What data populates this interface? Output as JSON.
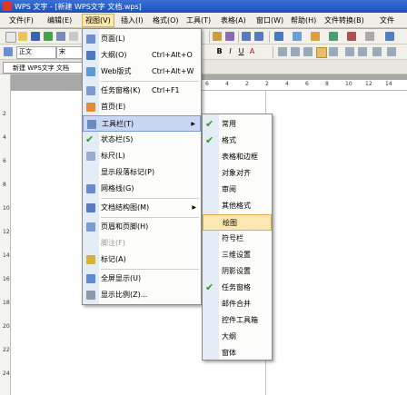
{
  "window": {
    "title": "WPS 文字 - [新建 WPS文字 文档.wps]"
  },
  "menubar": {
    "items": [
      "文件(F)",
      "编辑(E)",
      "视图(V)",
      "插入(I)",
      "格式(O)",
      "工具(T)",
      "表格(A)",
      "窗口(W)",
      "帮助(H)",
      "文件转换(B)",
      "文件"
    ]
  },
  "toolbar": {
    "style_value": "正文",
    "font_value": "宋",
    "format_buttons": [
      "B",
      "I",
      "U",
      "A"
    ]
  },
  "tabs": {
    "doc_tab": "新建 WPS文字 文档"
  },
  "ruler": {
    "marks": [
      "6",
      "4",
      "2",
      "2",
      "4",
      "6",
      "8",
      "10",
      "12",
      "14"
    ]
  },
  "vruler": {
    "marks": [
      "2",
      "4",
      "6",
      "8",
      "10",
      "12",
      "14",
      "16",
      "18",
      "20",
      "22",
      "24"
    ]
  },
  "view_menu": {
    "items": [
      {
        "label": "页面(L)",
        "shortcut": "",
        "icon": "page-icon"
      },
      {
        "label": "大纲(O)",
        "shortcut": "Ctrl+Alt+O",
        "icon": "outline-icon"
      },
      {
        "label": "Web版式",
        "shortcut": "Ctrl+Alt+W",
        "icon": "web-icon"
      },
      {
        "label": "任务窗格(K)",
        "shortcut": "Ctrl+F1",
        "icon": "taskpane-icon"
      },
      {
        "label": "首页(E)",
        "shortcut": "",
        "icon": "home-icon"
      },
      {
        "label": "工具栏(T)",
        "shortcut": "",
        "icon": "toolbar-icon"
      },
      {
        "label": "状态栏(S)",
        "shortcut": "",
        "icon": "check-icon"
      },
      {
        "label": "标尺(L)",
        "shortcut": "",
        "icon": "ruler-icon"
      },
      {
        "label": "显示段落标记(P)",
        "shortcut": "",
        "icon": ""
      },
      {
        "label": "网格线(G)",
        "shortcut": "",
        "icon": "grid-icon"
      },
      {
        "label": "文档结构图(M)",
        "shortcut": "",
        "icon": "docmap-icon"
      },
      {
        "label": "页眉和页脚(H)",
        "shortcut": "",
        "icon": "header-footer-icon"
      },
      {
        "label": "脚注(F)",
        "shortcut": "",
        "icon": ""
      },
      {
        "label": "标记(A)",
        "shortcut": "",
        "icon": "markup-icon"
      },
      {
        "label": "全屏显示(U)",
        "shortcut": "",
        "icon": "fullscreen-icon"
      },
      {
        "label": "显示比例(Z)...",
        "shortcut": "",
        "icon": "zoom-icon"
      }
    ]
  },
  "toolbar_submenu": {
    "items": [
      "常用",
      "格式",
      "表格和边框",
      "对象对齐",
      "审阅",
      "其他格式",
      "绘图",
      "符号栏",
      "三维设置",
      "阴影设置",
      "任务窗格",
      "邮件合并",
      "控件工具箱",
      "大纲",
      "窗体"
    ],
    "checked": [
      0,
      1,
      10
    ],
    "highlighted": 6
  },
  "colors": {
    "check": "#2a9a2a",
    "highlight": "#fbe8b0",
    "titlebar": "#1d4fb8"
  }
}
